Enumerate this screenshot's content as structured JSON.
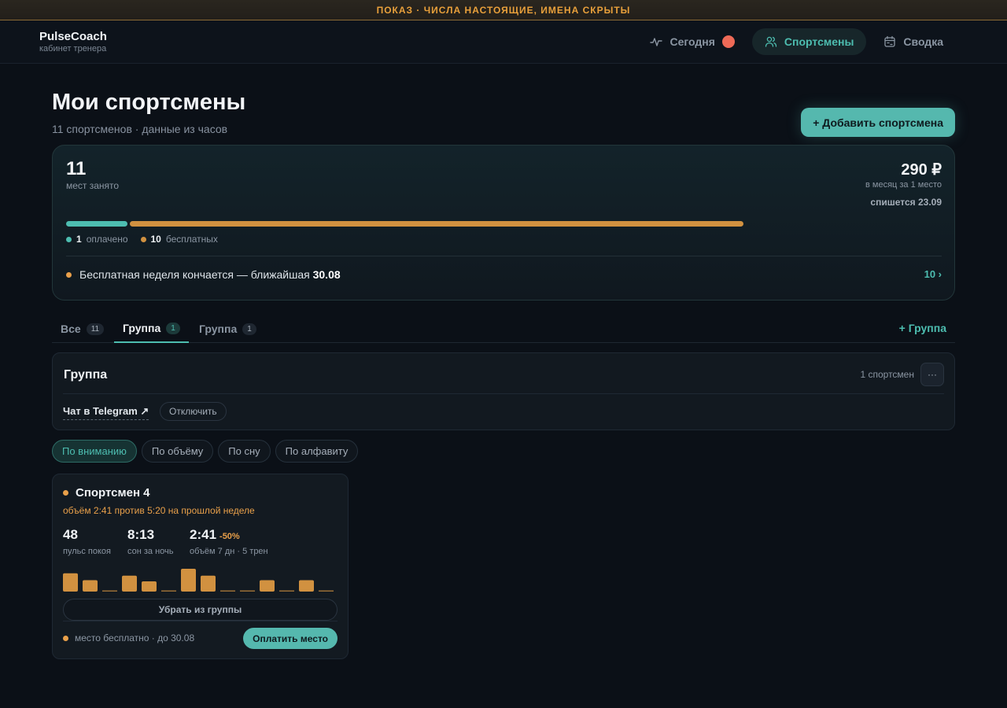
{
  "banner": "ПОКАЗ · ЧИСЛА НАСТОЯЩИЕ, ИМЕНА СКРЫТЫ",
  "brand": {
    "name": "PulseCoach",
    "subtitle": "кабинет тренера"
  },
  "nav": [
    {
      "label": "Сегодня",
      "icon": "pulse-icon",
      "active": false,
      "has_alert": true
    },
    {
      "label": "Спортсмены",
      "icon": "users-icon",
      "active": true
    },
    {
      "label": "Сводка",
      "icon": "calendar-icon",
      "active": false
    }
  ],
  "page": {
    "title": "Мои спортсмены",
    "subtitle": "11 спортсменов · данные из часов",
    "add_button": "+ Добавить спортсмена"
  },
  "summary": {
    "seats_taken": "11",
    "seats_label": "мест занято",
    "price": "290 ₽",
    "price_label": "в месяц за 1 место",
    "charge_date": "спишется 23.09",
    "paid_count": 1,
    "free_count": 10,
    "paid_label": "оплачено",
    "free_label": "бесплатных",
    "paid_color": "#4dbdb0",
    "free_color": "#d19140",
    "trial_text": "Бесплатная неделя кончается — ближайшая",
    "trial_date": "30.08",
    "trial_link": "10 ›"
  },
  "tabs": [
    {
      "label": "Все",
      "count": "11",
      "active": false
    },
    {
      "label": "Группа",
      "count": "1",
      "active": true
    },
    {
      "label": "Группа",
      "count": "1",
      "active": false
    }
  ],
  "add_group": "+ Группа",
  "group": {
    "title": "Группа",
    "count": "1 спортсмен",
    "more": "···",
    "telegram": "Чат в Telegram ↗",
    "disconnect": "Отключить"
  },
  "sorts": [
    {
      "label": "По вниманию",
      "active": true
    },
    {
      "label": "По объёму",
      "active": false
    },
    {
      "label": "По сну",
      "active": false
    },
    {
      "label": "По алфавиту",
      "active": false
    }
  ],
  "athlete": {
    "name": "Спортсмен 4",
    "alert": "объём 2:41 против 5:20 на прошлой неделе",
    "metrics": [
      {
        "value": "48",
        "label": "пульс покоя",
        "delta": ""
      },
      {
        "value": "8:13",
        "label": "сон за ночь",
        "delta": ""
      },
      {
        "value": "2:41",
        "label": "объём 7 дн · 5 трен",
        "delta": "-50%"
      }
    ],
    "spark_values": [
      0.8,
      0.5,
      0,
      0.7,
      0.45,
      0,
      1.0,
      0.7,
      0,
      0,
      0.5,
      0,
      0.5,
      0
    ],
    "spark_color": "#d19140",
    "remove_button": "Убрать из группы",
    "seat_info": "место бесплатно · до 30.08",
    "pay_button": "Оплатить место"
  }
}
